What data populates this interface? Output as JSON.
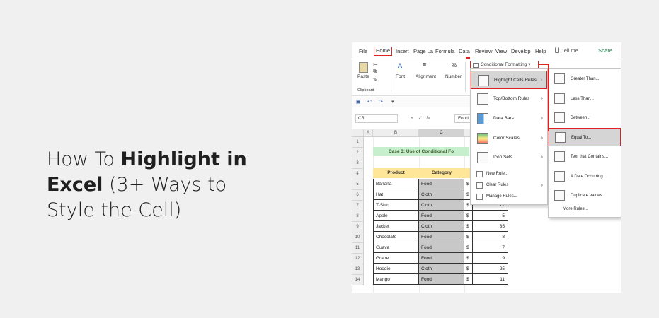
{
  "headline": {
    "part1": "How To ",
    "bold1": "Highlight in",
    "bold2": "Excel",
    "part2": " (3+ Ways to",
    "line3": "Style the Cell)"
  },
  "ribbon_tabs": [
    "File",
    "Home",
    "Insert",
    "Page La",
    "Formula",
    "Data",
    "Review",
    "View",
    "Develop",
    "Help"
  ],
  "tell_me": "Tell me",
  "share": "Share",
  "ribbon": {
    "paste": "Paste",
    "font": "Font",
    "alignment": "Alignment",
    "number": "Number",
    "clipboard": "Clipboard",
    "conditional_formatting": "Conditional Formatting"
  },
  "formula_bar": {
    "name_box": "C5",
    "value": "Food"
  },
  "columns": [
    "A",
    "B",
    "C"
  ],
  "rows": [
    "1",
    "2",
    "3",
    "4",
    "5",
    "6",
    "7",
    "8",
    "9",
    "10",
    "11",
    "12",
    "13",
    "14"
  ],
  "case_title": "Case 3: Use of Conditional Fo",
  "table_headers": [
    "Product",
    "Category"
  ],
  "table_rows": [
    {
      "product": "Banana",
      "category": "Food",
      "cur": "$",
      "amt": ""
    },
    {
      "product": "Hat",
      "category": "Cloth",
      "cur": "$",
      "amt": ""
    },
    {
      "product": "T-Shirt",
      "category": "Cloth",
      "cur": "$",
      "amt": "12"
    },
    {
      "product": "Apple",
      "category": "Food",
      "cur": "$",
      "amt": "5"
    },
    {
      "product": "Jacket",
      "category": "Cloth",
      "cur": "$",
      "amt": "35"
    },
    {
      "product": "Chocolate",
      "category": "Food",
      "cur": "$",
      "amt": "8"
    },
    {
      "product": "Guava",
      "category": "Food",
      "cur": "$",
      "amt": "7"
    },
    {
      "product": "Grape",
      "category": "Food",
      "cur": "$",
      "amt": "9"
    },
    {
      "product": "Hoodie",
      "category": "Cloth",
      "cur": "$",
      "amt": "25"
    },
    {
      "product": "Mango",
      "category": "Food",
      "cur": "$",
      "amt": "11"
    }
  ],
  "cf_menu": {
    "items": [
      "Highlight Cells Rules",
      "Top/Bottom Rules",
      "Data Bars",
      "Color Scales",
      "Icon Sets"
    ],
    "small_items": [
      "New Rule...",
      "Clear Rules",
      "Manage Rules..."
    ]
  },
  "highlight_menu": {
    "items": [
      "Greater Than...",
      "Less Than...",
      "Between...",
      "Equal To...",
      "Text that Contains...",
      "A Date Occurring...",
      "Duplicate Values..."
    ],
    "more": "More Rules..."
  },
  "colors": {
    "accent_red": "#dd2222",
    "header_yellow": "#ffe699",
    "title_green": "#c6efce",
    "excel_green": "#217346"
  }
}
